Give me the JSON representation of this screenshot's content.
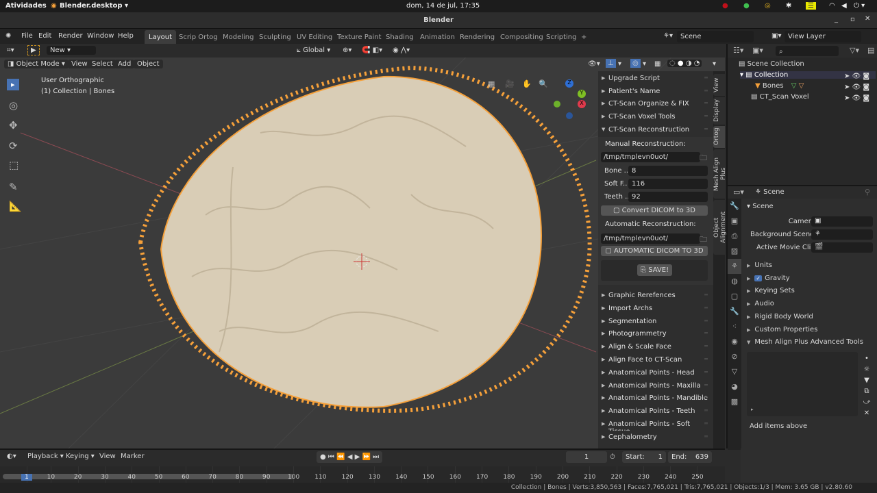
{
  "system_bar": {
    "activities": "Atividades",
    "app": "Blender.desktop ▾",
    "clock": "dom, 14 de jul, 17:35"
  },
  "window": {
    "title": "Blender"
  },
  "menu": [
    "File",
    "Edit",
    "Render",
    "Window",
    "Help"
  ],
  "workspaces": [
    {
      "label": "Layout",
      "active": true
    },
    {
      "label": "Scrip Ortog"
    },
    {
      "label": "Modeling"
    },
    {
      "label": "Sculpting"
    },
    {
      "label": "UV Editing"
    },
    {
      "label": "Texture Paint"
    },
    {
      "label": "Shading"
    },
    {
      "label": "Animation"
    },
    {
      "label": "Rendering"
    },
    {
      "label": "Compositing"
    },
    {
      "label": "Scripting"
    }
  ],
  "add_workspace": "+",
  "scene_field": "Scene",
  "view_layer_field": "View Layer",
  "tool_header": {
    "new": "New",
    "orientation": "Global"
  },
  "viewport_header": {
    "mode": "Object Mode",
    "view": "View",
    "select": "Select",
    "add": "Add",
    "object": "Object"
  },
  "viewport": {
    "view_name": "User Orthographic",
    "context": "(1) Collection | Bones",
    "gizmo": {
      "x": "X",
      "y": "Y",
      "z": "Z"
    },
    "accent": "#f5a03a"
  },
  "npanel": {
    "collapsed_top": [
      "Upgrade Script",
      "Patient's Name",
      "CT-Scan Organize & FIX",
      "CT-Scan Voxel Tools"
    ],
    "open": "CT-Scan Reconstruction",
    "manual_label": "Manual Reconstruction:",
    "manual_path": "/tmp/tmplevn0uot/",
    "fields": [
      {
        "label": "Bone ..",
        "value": "8"
      },
      {
        "label": "Soft F..",
        "value": "116"
      },
      {
        "label": "Teeth ..",
        "value": "92"
      }
    ],
    "convert": "Convert DICOM to 3D",
    "auto_label": "Automatic Reconstruction:",
    "auto_path": "/tmp/tmplevn0uot/",
    "auto_btn": "AUTOMATIC DICOM TO 3D",
    "save": "SAVE!",
    "collapsed_bottom": [
      "Graphic Rerefences",
      "Import Archs",
      "Segmentation",
      "Photogrammetry",
      "Align & Scale Face",
      "Align Face to CT-Scan",
      "Anatomical Points - Head",
      "Anatomical Points - Maxilla",
      "Anatomical Points - Mandible",
      "Anatomical Points - Teeth",
      "Anatomical Points - Soft Tissue",
      "Cephalometry"
    ],
    "tabs": [
      "View",
      "Display",
      "Ortog",
      "Mesh Align Plus",
      "Object Alignment"
    ]
  },
  "outliner": {
    "root": "Scene Collection",
    "items": [
      {
        "name": "Collection",
        "level": 1
      },
      {
        "name": "Bones",
        "level": 2
      },
      {
        "name": "CT_Scan Voxel",
        "level": 1
      }
    ]
  },
  "properties": {
    "header": "Scene",
    "section": "Scene",
    "camera_label": "Camera",
    "bg_label": "Background Scene",
    "clip_label": "Active Movie Clip",
    "panels": [
      "Units",
      "Gravity",
      "Keying Sets",
      "Audio",
      "Rigid Body World",
      "Custom Properties",
      "Mesh Align Plus Advanced Tools"
    ],
    "gravity_checked": true,
    "add_items": "Add items above"
  },
  "timeline": {
    "menus": [
      "Playback",
      "Keying",
      "View",
      "Marker"
    ],
    "current_frame": "1",
    "start_label": "Start:",
    "start": "1",
    "end_label": "End:",
    "end": "639",
    "ticks": [
      "1",
      "10",
      "20",
      "30",
      "40",
      "50",
      "60",
      "70",
      "80",
      "90",
      "100",
      "110",
      "120",
      "130",
      "140",
      "150",
      "160",
      "170",
      "180",
      "190",
      "200",
      "210",
      "220",
      "230",
      "240",
      "250"
    ]
  },
  "status": "Collection | Bones | Verts:3,850,563 | Faces:7,765,021 | Tris:7,765,021 | Objects:1/3 | Mem: 3.65 GB | v2.80.60"
}
